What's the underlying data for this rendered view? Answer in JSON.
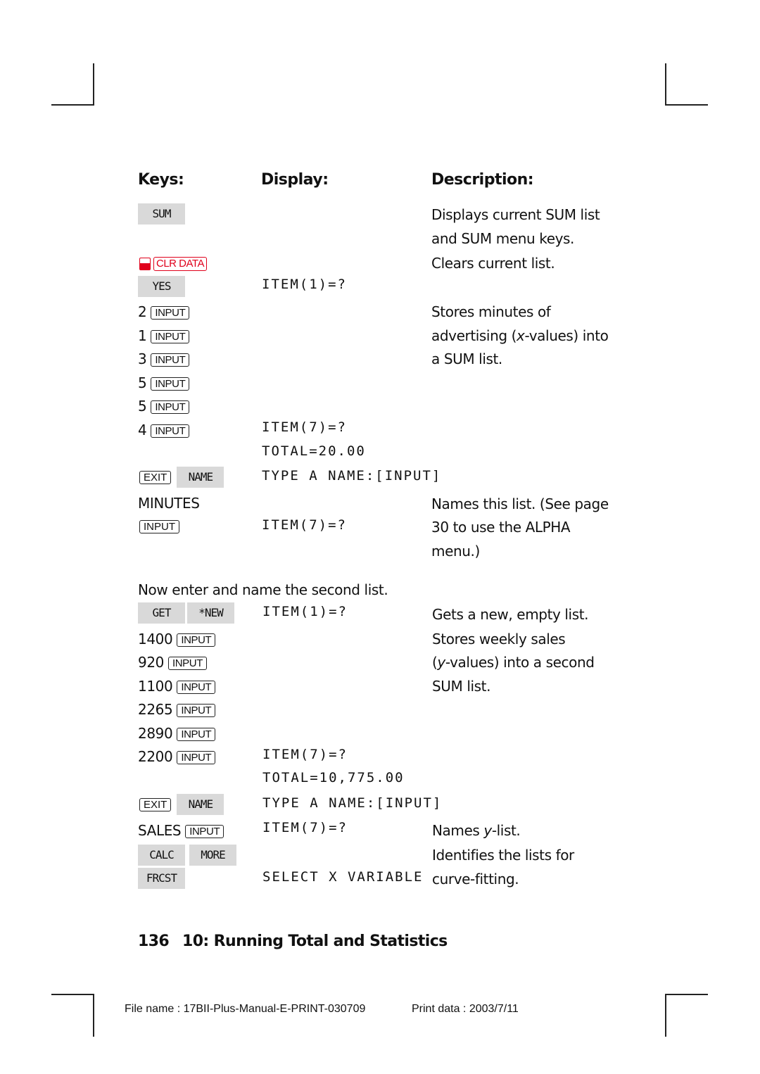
{
  "headers": {
    "keys": "Keys:",
    "display": "Display:",
    "description": "Description:"
  },
  "rows1": {
    "sum_key": "SUM",
    "clr_data": "CLR DATA",
    "yes_key": "YES",
    "item1": "ITEM(1)=?",
    "input_label": "INPUT",
    "x_values": [
      "2",
      "1",
      "3",
      "5",
      "5",
      "4"
    ],
    "item7": "ITEM(7)=?",
    "total1": "TOTAL=20.00",
    "exit_label": "EXIT",
    "name_key": "NAME",
    "type_name": "TYPE A NAME:[INPUT]",
    "minutes": "MINUTES",
    "item7b": "ITEM(7)=?"
  },
  "desc1": {
    "displays_1": "Displays current SUM list",
    "displays_2": "and SUM menu keys.",
    "clears": "Clears current list.",
    "stores_1": "Stores minutes of",
    "stores_2a": "advertising (",
    "stores_2i": "x",
    "stores_2b": "-values) into",
    "stores_3": "a SUM list.",
    "names_1": "Names this list. (See page",
    "names_2": "30 to use the ALPHA",
    "names_3": "menu.)"
  },
  "intro2": "Now enter and name the second list.",
  "rows2": {
    "get_key": "GET",
    "new_key": "*NEW",
    "item1": "ITEM(1)=?",
    "y_values": [
      "1400",
      "920",
      "1100",
      "2265",
      "2890",
      "2200"
    ],
    "item7": "ITEM(7)=?",
    "total2": "TOTAL=10,775.00",
    "exit_label": "EXIT",
    "name_key": "NAME",
    "type_name": "TYPE A NAME:[INPUT]",
    "sales": "SALES",
    "item7b": "ITEM(7)=?",
    "calc_key": "CALC",
    "more_key": "MORE",
    "frcst_key": "FRCST",
    "select_x": "SELECT X VARIABLE"
  },
  "desc2": {
    "gets": "Gets a new, empty list.",
    "stores_1": "Stores weekly sales",
    "stores_2a": "(",
    "stores_2i": "y",
    "stores_2b": "-values) into a second",
    "stores_3": "SUM list.",
    "names_a": "Names ",
    "names_i": "y",
    "names_b": "-list.",
    "ident_1": "Identifies the lists for",
    "ident_2": "curve-fitting."
  },
  "footer": {
    "page_number": "136",
    "chapter": "10: Running Total and Statistics",
    "file_name": "File name : 17BII-Plus-Manual-E-PRINT-030709",
    "print_data": "Print data : 2003/7/11"
  },
  "colors": {
    "shift_red": "#e0001b",
    "softkey_gray": "#d9d9d9"
  }
}
